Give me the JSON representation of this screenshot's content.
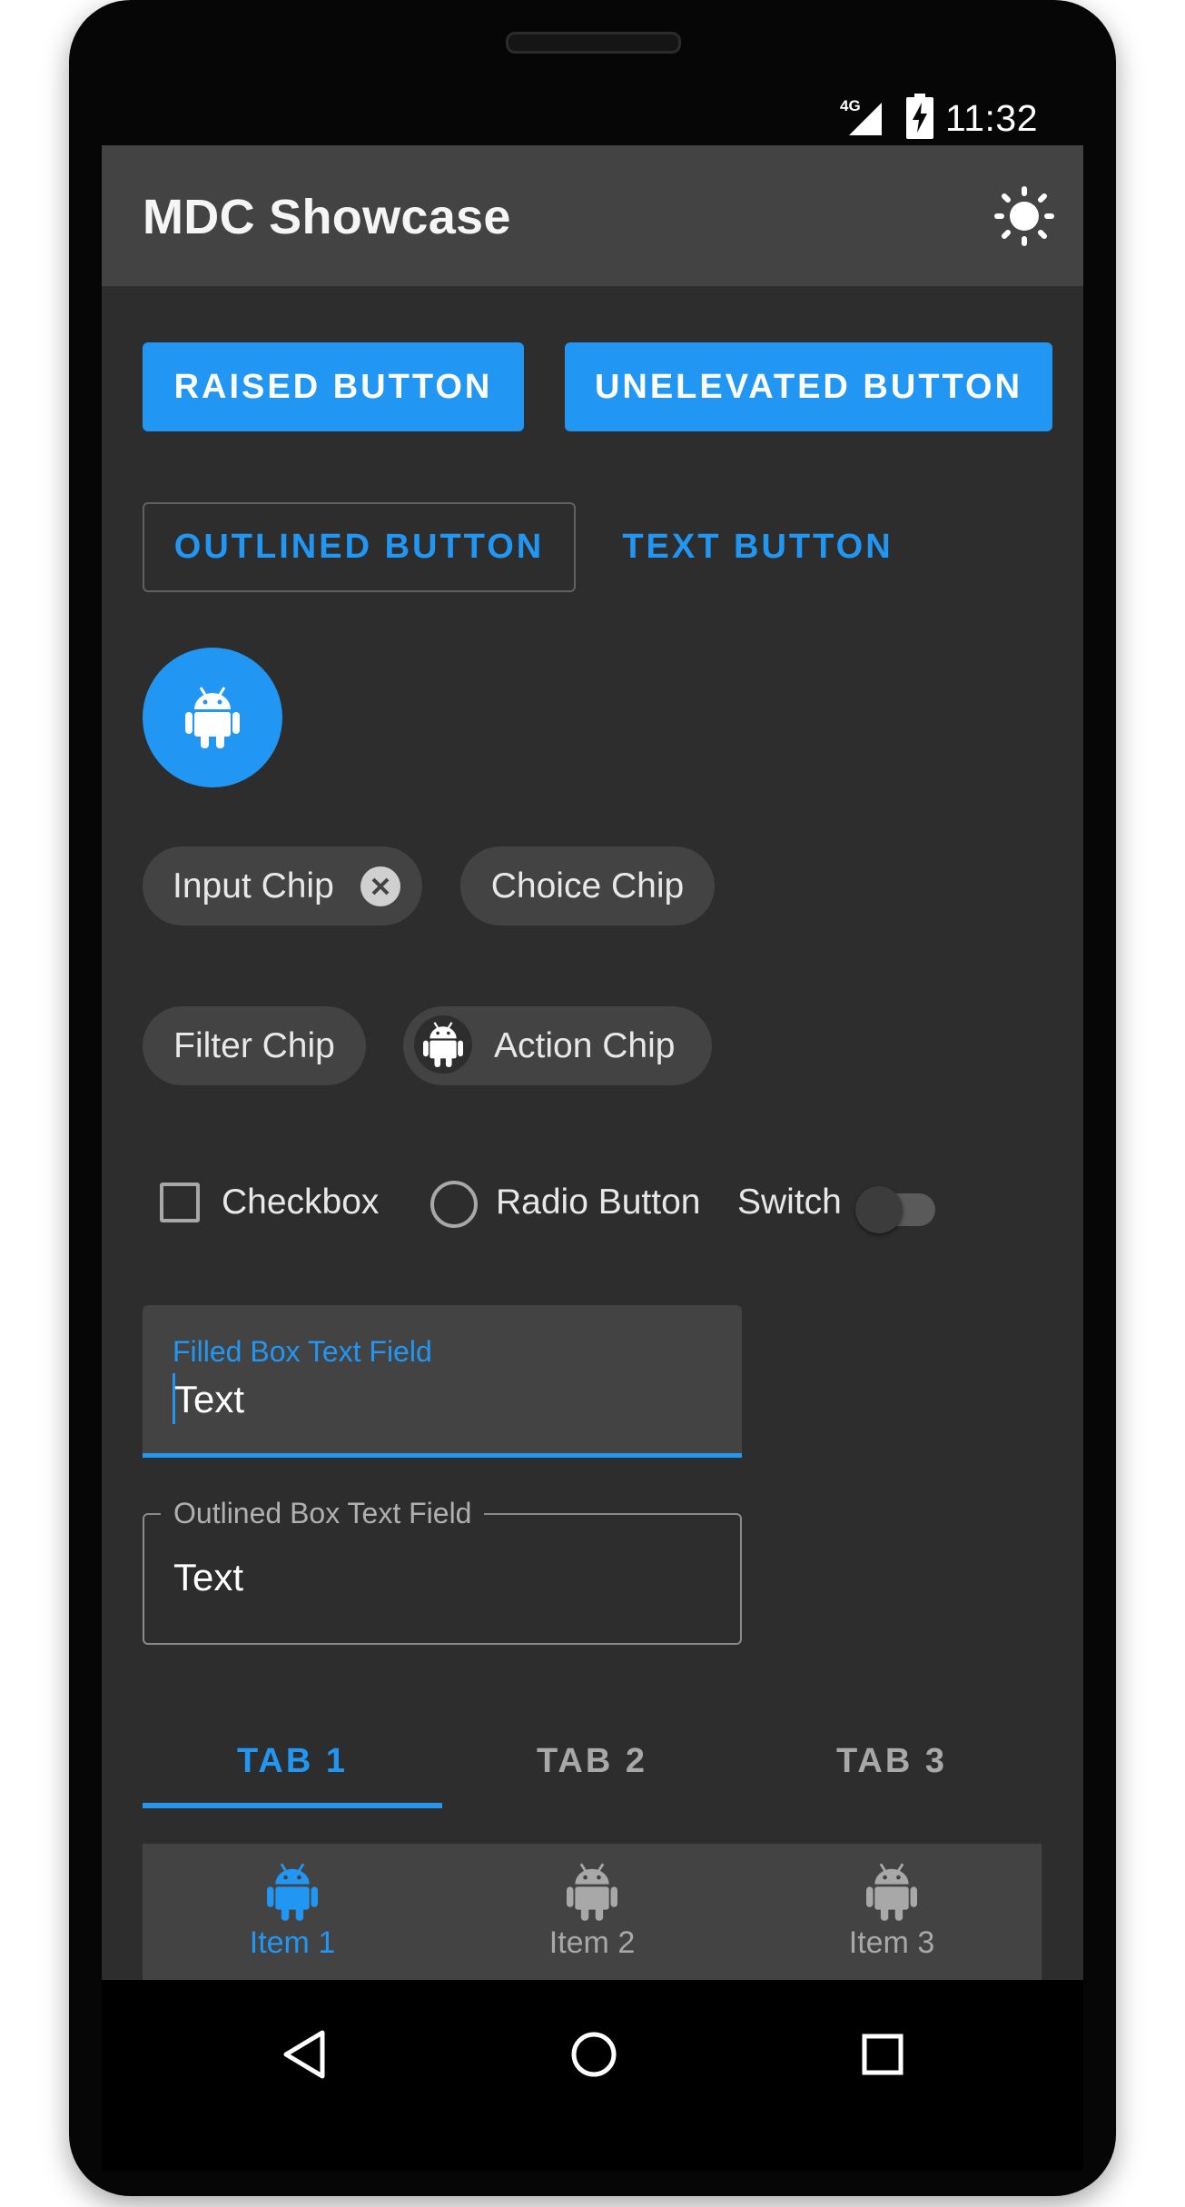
{
  "status_bar": {
    "network": "4G",
    "time": "11:32"
  },
  "app_bar": {
    "title": "MDC Showcase",
    "action_icon": "brightness-icon"
  },
  "buttons": {
    "raised": "RAISED BUTTON",
    "unelevated": "UNELEVATED BUTTON",
    "outlined": "OUTLINED BUTTON",
    "text": "TEXT BUTTON"
  },
  "fab": {
    "icon": "android-icon"
  },
  "chips": {
    "input": "Input Chip",
    "choice": "Choice Chip",
    "filter": "Filter Chip",
    "action": "Action Chip"
  },
  "selection_controls": {
    "checkbox": "Checkbox",
    "radio": "Radio Button",
    "switch": "Switch"
  },
  "text_fields": {
    "filled": {
      "label": "Filled Box Text Field",
      "value": "Text"
    },
    "outlined": {
      "label": "Outlined Box Text Field",
      "value": "Text"
    }
  },
  "tabs": [
    {
      "label": "TAB 1"
    },
    {
      "label": "TAB 2"
    },
    {
      "label": "TAB 3"
    }
  ],
  "bottom_nav": [
    {
      "label": "Item 1"
    },
    {
      "label": "Item 2"
    },
    {
      "label": "Item 3"
    }
  ],
  "colors": {
    "accent": "#2196f3",
    "surface": "#2d2d2d",
    "app_bar": "#434343",
    "chip": "#434343",
    "text_primary": "#e8e8e8",
    "text_inactive": "#a8a8a8"
  }
}
